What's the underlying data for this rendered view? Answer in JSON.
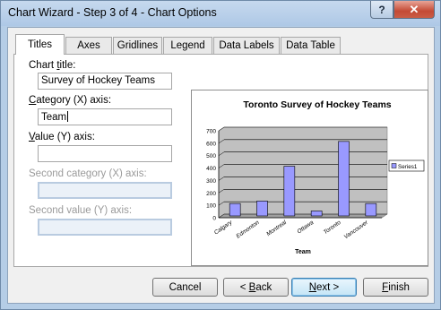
{
  "window": {
    "title": "Chart Wizard - Step 3 of 4 - Chart Options",
    "help_label": "?",
    "close_label": "✕"
  },
  "tabs": [
    {
      "label": "Titles",
      "active": true
    },
    {
      "label": "Axes",
      "active": false
    },
    {
      "label": "Gridlines",
      "active": false
    },
    {
      "label": "Legend",
      "active": false
    },
    {
      "label": "Data Labels",
      "active": false
    },
    {
      "label": "Data Table",
      "active": false
    }
  ],
  "form": {
    "chart_title": {
      "pre": "Chart ",
      "key": "t",
      "post": "itle:",
      "value": "Survey of Hockey Teams"
    },
    "category_axis": {
      "pre": "",
      "key": "C",
      "post": "ategory (X) axis:",
      "value": "Team"
    },
    "value_axis": {
      "pre": "",
      "key": "V",
      "post": "alue (Y) axis:",
      "value": ""
    },
    "second_category_axis": {
      "label": "Second category (X) axis:",
      "value": ""
    },
    "second_value_axis": {
      "label": "Second value (Y) axis:",
      "value": ""
    }
  },
  "buttons": {
    "cancel": "Cancel",
    "back": {
      "pre": "< ",
      "key": "B",
      "post": "ack"
    },
    "next": {
      "pre": "",
      "key": "N",
      "post": "ext >"
    },
    "finish": {
      "pre": "",
      "key": "F",
      "post": "inish"
    }
  },
  "chart_data": {
    "type": "bar",
    "title": "Toronto Survey of Hockey Teams",
    "xlabel": "Team",
    "ylabel": "",
    "categories": [
      "Calgary",
      "Edmonton",
      "Montreal",
      "Ottawa",
      "Toronto",
      "Vancouver"
    ],
    "series": [
      {
        "name": "Series1",
        "values": [
          100,
          120,
          400,
          40,
          600,
          100
        ]
      }
    ],
    "ylim": [
      0,
      700
    ],
    "yticks": [
      0,
      100,
      200,
      300,
      400,
      500,
      600,
      700
    ],
    "grid": true,
    "legend": "right",
    "colors": {
      "bar": "#9999ff",
      "plot_area": "#c0c0c0",
      "bar_edge": "#000000"
    }
  }
}
